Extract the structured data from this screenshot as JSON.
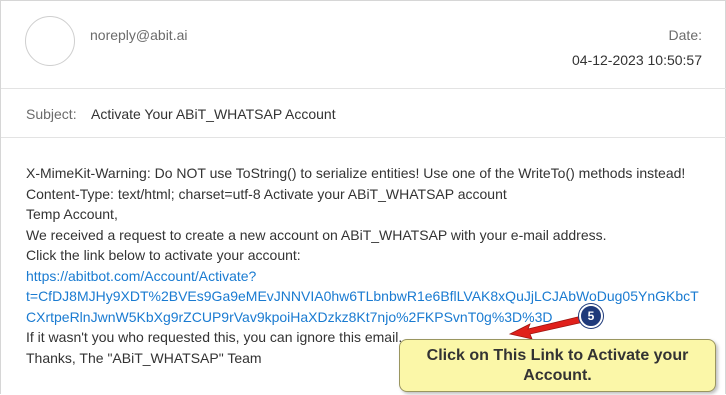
{
  "email": {
    "from": "noreply@abit.ai",
    "date_label": "Date:",
    "date_value": "04-12-2023 10:50:57",
    "subject_label": "Subject:",
    "subject_value": "Activate Your ABiT_WHATSAP Account",
    "body_lines": [
      "X-MimeKit-Warning: Do NOT use ToString() to serialize entities! Use one of the WriteTo() methods instead!",
      "Content-Type: text/html; charset=utf-8 Activate your ABiT_WHATSAP account",
      "Temp Account,",
      "We received a request to create a new account on ABiT_WHATSAP with your e-mail address.",
      "Click the link below to activate your account:"
    ],
    "link_lines": [
      "https://abitbot.com/Account/Activate?",
      "t=CfDJ8MJHy9XDT%2BVEs9Ga9eMEvJNNVIA0hw6TLbnbwR1e6BflLVAK8xQuJjLCJAbWoDug05YnGKbcT",
      "CXrtpeRlnJwnW5KbXg9rZCUP9rVav9kpoiHaXDzkz8Kt7njo%2FKPSvnT0g%3D%3D"
    ],
    "closing_lines": [
      "If it wasn't you who requested this, you can ignore this email.",
      "Thanks, The \"ABiT_WHATSAP\" Team"
    ]
  },
  "annotation": {
    "step_number": "5",
    "callout_text": "Click on This Link to Activate your Account.",
    "callout_color": "#fbf7a8",
    "arrow_color": "#e0201b",
    "badge_color": "#1f3a7a"
  }
}
